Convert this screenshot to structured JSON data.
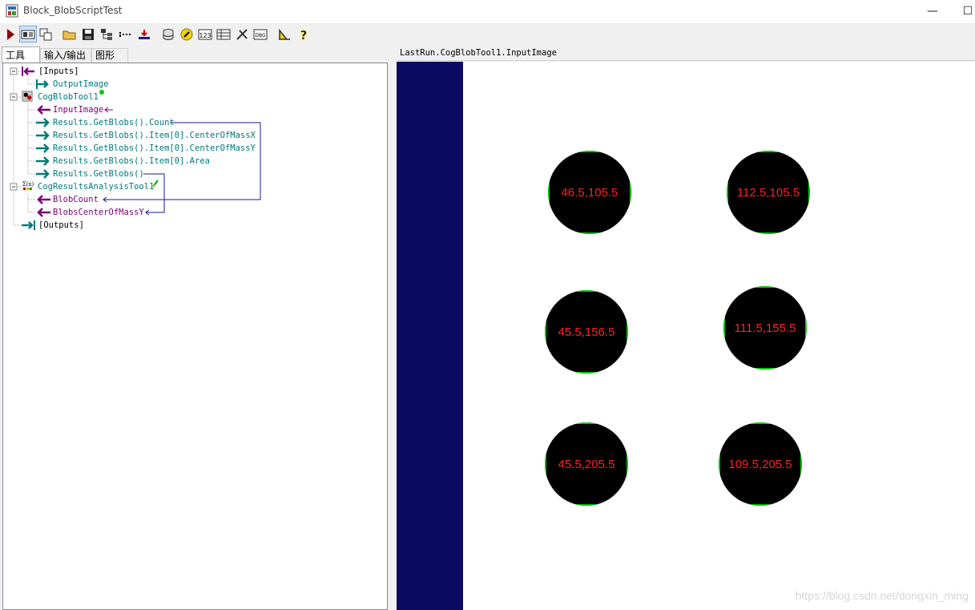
{
  "window": {
    "title": "Block_BlobScriptTest",
    "minimize_glyph": "—",
    "maximize_glyph": "☐"
  },
  "toolbar": {
    "buttons": [
      {
        "name": "run-icon",
        "color": "#8b0000"
      },
      {
        "name": "display-toggle-icon",
        "pressed": true
      },
      {
        "name": "float-window-icon"
      },
      {
        "name": "open-folder-icon"
      },
      {
        "name": "save-icon"
      },
      {
        "name": "tree-view-icon"
      },
      {
        "name": "dotted-line-icon"
      },
      {
        "name": "import-icon"
      },
      {
        "name": "database-icon"
      },
      {
        "name": "link-icon"
      },
      {
        "name": "counter-icon",
        "text": "123"
      },
      {
        "name": "result-grid-icon"
      },
      {
        "name": "settings-tools-icon"
      },
      {
        "name": "debug-icon",
        "text": "DBG"
      },
      {
        "name": "measure-icon"
      },
      {
        "name": "help-icon",
        "text": "?"
      }
    ]
  },
  "tabs": [
    {
      "label": "工具",
      "active": true
    },
    {
      "label": "输入/输出",
      "active": false
    },
    {
      "label": "图形",
      "active": false
    }
  ],
  "tree": {
    "inputs_label": "[Inputs]",
    "output_image": "OutputImage",
    "blob_tool": "CogBlobTool1",
    "input_image": "InputImage",
    "result_count": "Results.GetBlobs().Count",
    "result_cmx": "Results.GetBlobs().Item[0].CenterOfMassX",
    "result_cmy": "Results.GetBlobs().Item[0].CenterOfMassY",
    "result_area": "Results.GetBlobs().Item[0].Area",
    "result_blobs": "Results.GetBlobs()",
    "analysis_tool": "CogResultsAnalysisTool1",
    "blob_count": "BlobCount",
    "blobs_cmy": "BlobsCenterOfMassY",
    "outputs_label": "[Outputs]",
    "colors": {
      "teal": "#007a7a",
      "purple": "#7a007a",
      "link": "#1a1a8c"
    }
  },
  "display": {
    "header": "LastRun.CogBlobTool1.InputImage",
    "strip_color": "#0a0a63",
    "blob_edge_color": "#00cc00",
    "label_color": "#ff2020",
    "blobs": [
      {
        "label": "46.5,105.5"
      },
      {
        "label": "112.5,105.5"
      },
      {
        "label": "45.5,156.5"
      },
      {
        "label": "111.5,155.5"
      },
      {
        "label": "45.5,205.5"
      },
      {
        "label": "109.5,205.5"
      }
    ],
    "watermark": "https://blog.csdn.net/dongxin_ming"
  }
}
